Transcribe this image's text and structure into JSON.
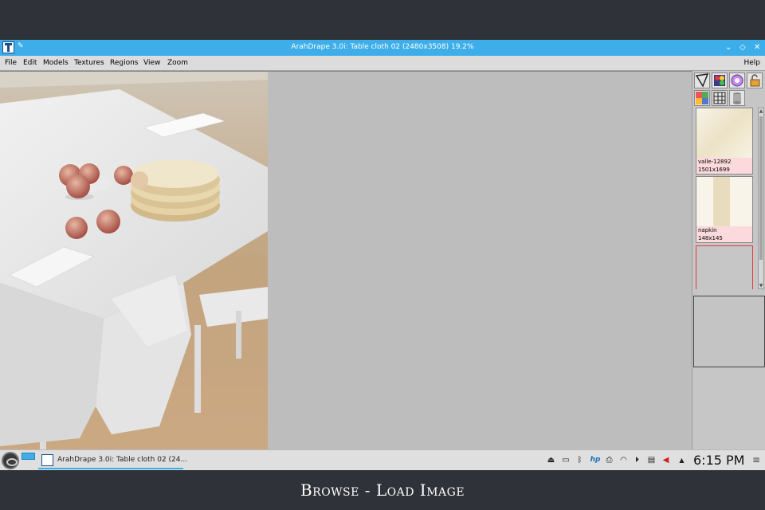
{
  "window": {
    "title": "ArahDrape 3.0i: Table cloth 02 (2480x3508) 19.2%"
  },
  "menubar": {
    "items": [
      "File",
      "Edit",
      "Models",
      "Textures",
      "Regions",
      "View",
      "Zoom"
    ],
    "help": "Help"
  },
  "thumbnails": [
    {
      "name": "valle-12892",
      "size": "1501x1699"
    },
    {
      "name": "napkin",
      "size": "148x145"
    }
  ],
  "taskbar": {
    "task_label": "ArahDrape 3.0i: Table cloth 02 (24...",
    "clock": "6:15 PM"
  },
  "caption": "Browse - Load Image",
  "colors": {
    "titlebar": "#3daee9",
    "thumb_label_bg": "#fcd9dc",
    "selected_thumb_border": "#e23b3b"
  }
}
